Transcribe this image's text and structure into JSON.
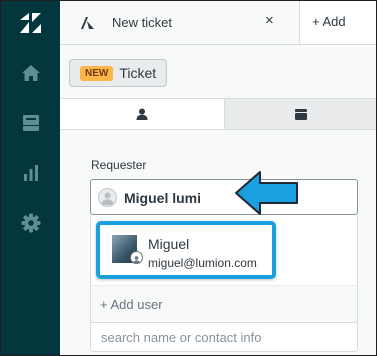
{
  "sidenav": {
    "items": [
      {
        "icon": "zendesk-logo-icon"
      },
      {
        "icon": "home-icon"
      },
      {
        "icon": "inbox-icon"
      },
      {
        "icon": "bar-chart-icon"
      },
      {
        "icon": "gear-icon"
      }
    ],
    "background": "#03363d"
  },
  "tabs": {
    "active_title": "New ticket",
    "close_glyph": "×",
    "add_label": "+ Add"
  },
  "ticket": {
    "badge": "NEW",
    "label": "Ticket"
  },
  "form": {
    "requester_label": "Requester",
    "requester_value": "Miguel lumi",
    "suggestion": {
      "name": "Miguel",
      "email": "miguel@lumion.com"
    },
    "add_user_label": "+ Add user",
    "search_placeholder": "search name or contact info"
  },
  "colors": {
    "highlight": "#1a9fe0",
    "badge": "#ffb648"
  }
}
